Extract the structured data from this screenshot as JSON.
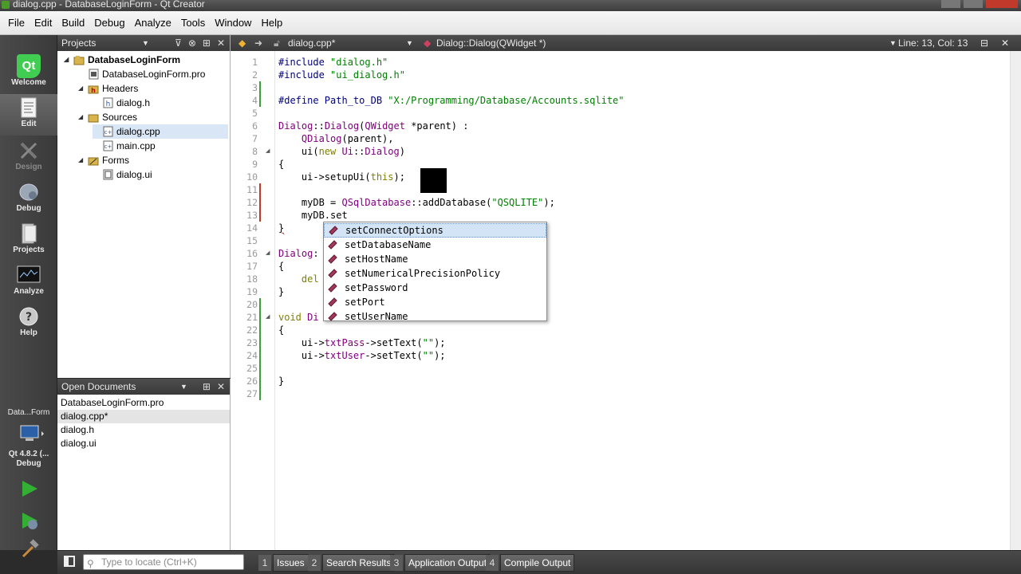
{
  "window": {
    "title": "dialog.cpp - DatabaseLoginForm - Qt Creator"
  },
  "menu": [
    "File",
    "Edit",
    "Build",
    "Debug",
    "Analyze",
    "Tools",
    "Window",
    "Help"
  ],
  "modes": {
    "welcome": "Welcome",
    "edit": "Edit",
    "design": "Design",
    "debug": "Debug",
    "projects": "Projects",
    "analyze": "Analyze",
    "help": "Help",
    "qt_logo": "Qt"
  },
  "kit": {
    "project": "Data...Form",
    "kit_line1": "Qt 4.8.2 (...",
    "kit_line2": "Debug"
  },
  "projects_pane": {
    "title": "Projects",
    "tree": [
      {
        "label": "DatabaseLoginForm",
        "bold": true
      },
      {
        "label": "DatabaseLoginForm.pro"
      },
      {
        "label": "Headers"
      },
      {
        "label": "dialog.h"
      },
      {
        "label": "Sources"
      },
      {
        "label": "dialog.cpp",
        "selected": true
      },
      {
        "label": "main.cpp"
      },
      {
        "label": "Forms"
      },
      {
        "label": "dialog.ui"
      }
    ]
  },
  "open_documents": {
    "title": "Open Documents",
    "items": [
      "DatabaseLoginForm.pro",
      "dialog.cpp*",
      "dialog.h",
      "dialog.ui"
    ]
  },
  "editor_toolbar": {
    "file": "dialog.cpp*",
    "symbol": "Dialog::Dialog(QWidget *)",
    "position": "Line: 13, Col: 13"
  },
  "code_lines": [
    {
      "n": "1",
      "text": "#include \"dialog.h\""
    },
    {
      "n": "2",
      "text": "#include \"ui_dialog.h\""
    },
    {
      "n": "3",
      "text": ""
    },
    {
      "n": "4",
      "text": "#define Path_to_DB \"X:/Programming/Database/Accounts.sqlite\""
    },
    {
      "n": "5",
      "text": ""
    },
    {
      "n": "6",
      "text": "Dialog::Dialog(QWidget *parent) :"
    },
    {
      "n": "7",
      "text": "    QDialog(parent),"
    },
    {
      "n": "8",
      "text": "    ui(new Ui::Dialog)"
    },
    {
      "n": "9",
      "text": "{"
    },
    {
      "n": "10",
      "text": "    ui->setupUi(this);"
    },
    {
      "n": "11",
      "text": ""
    },
    {
      "n": "12",
      "text": "    myDB = QSqlDatabase::addDatabase(\"QSQLITE\");"
    },
    {
      "n": "13",
      "text": "    myDB.set"
    },
    {
      "n": "14",
      "text": "}"
    },
    {
      "n": "15",
      "text": ""
    },
    {
      "n": "16",
      "text": "Dialog:"
    },
    {
      "n": "17",
      "text": "{"
    },
    {
      "n": "18",
      "text": "    del"
    },
    {
      "n": "19",
      "text": "}"
    },
    {
      "n": "20",
      "text": ""
    },
    {
      "n": "21",
      "text": "void Di"
    },
    {
      "n": "22",
      "text": "{"
    },
    {
      "n": "23",
      "text": "    ui->txtPass->setText(\"\");"
    },
    {
      "n": "24",
      "text": "    ui->txtUser->setText(\"\");"
    },
    {
      "n": "25",
      "text": ""
    },
    {
      "n": "26",
      "text": "}"
    },
    {
      "n": "27",
      "text": ""
    }
  ],
  "completion": {
    "items": [
      "setConnectOptions",
      "setDatabaseName",
      "setHostName",
      "setNumericalPrecisionPolicy",
      "setPassword",
      "setPort",
      "setUserName"
    ],
    "selected_index": 0
  },
  "statusbar": {
    "locator_placeholder": "Type to locate (Ctrl+K)",
    "panes": [
      {
        "num": "1",
        "label": "Issues"
      },
      {
        "num": "2",
        "label": "Search Results"
      },
      {
        "num": "3",
        "label": "Application Output"
      },
      {
        "num": "4",
        "label": "Compile Output"
      }
    ]
  },
  "colors": {
    "preprocessor": "#000080",
    "string": "#008000",
    "type": "#800080",
    "keyword": "#808000",
    "selection": "#d3e4f7",
    "run_green": "#33b033"
  }
}
